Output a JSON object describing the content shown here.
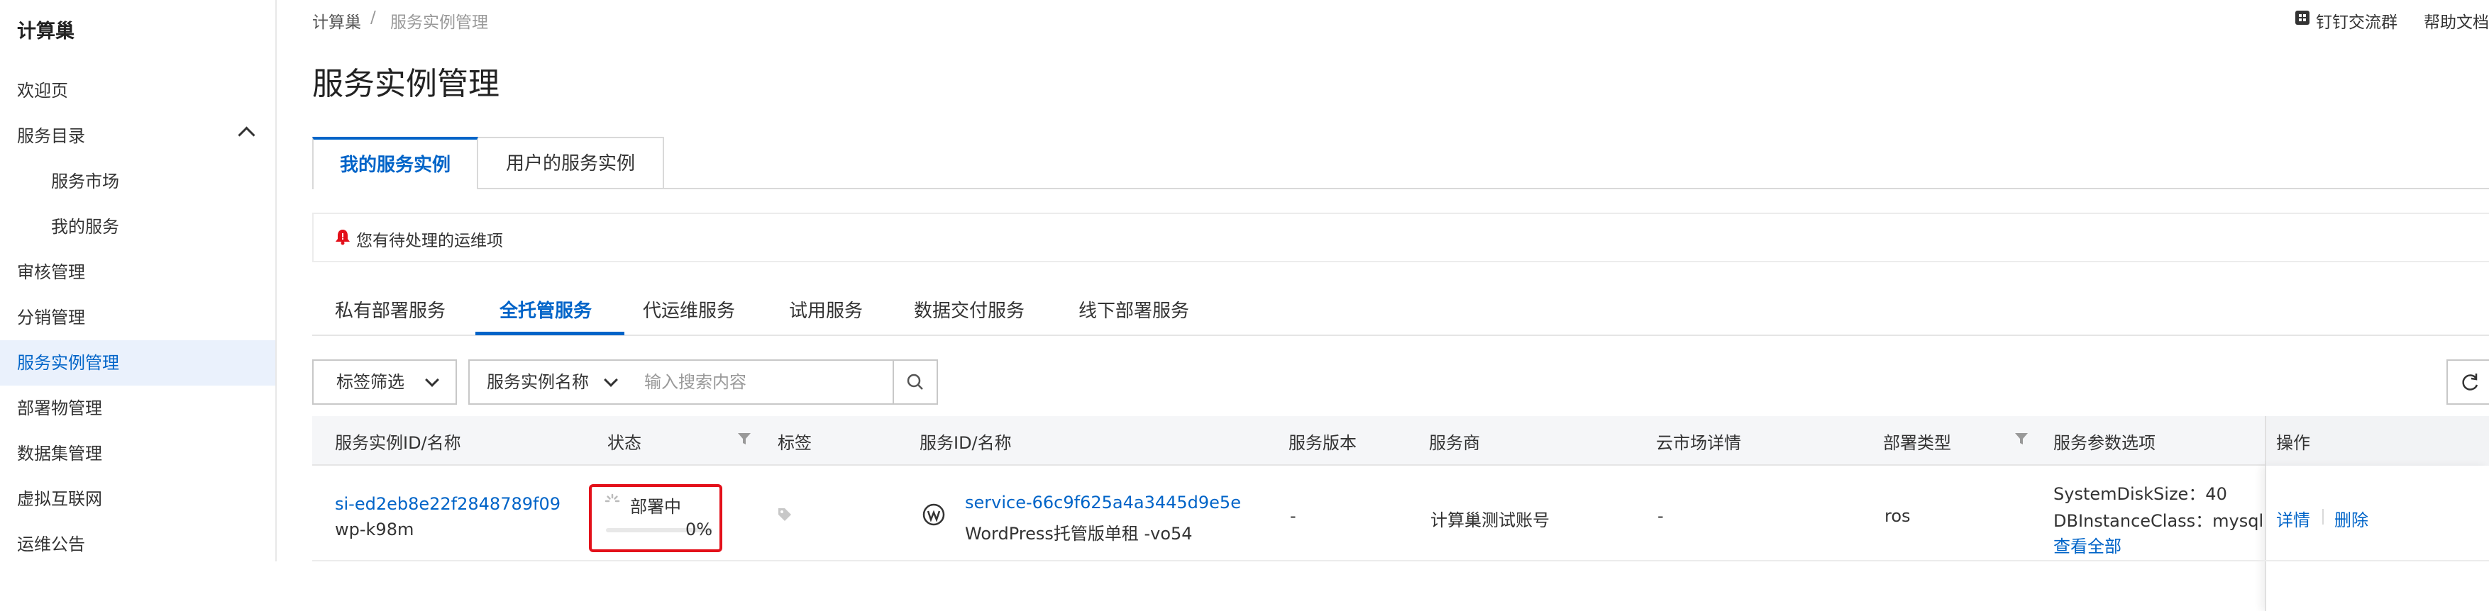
{
  "sidebar": {
    "title": "计算巢",
    "items": [
      {
        "label": "欢迎页"
      },
      {
        "label": "服务目录"
      },
      {
        "label": "服务市场"
      },
      {
        "label": "我的服务"
      },
      {
        "label": "审核管理"
      },
      {
        "label": "分销管理"
      },
      {
        "label": "服务实例管理"
      },
      {
        "label": "部署物管理"
      },
      {
        "label": "数据集管理"
      },
      {
        "label": "虚拟互联网"
      },
      {
        "label": "运维公告"
      }
    ]
  },
  "header": {
    "breadcrumb": [
      "计算巢",
      "服务实例管理"
    ],
    "separator": "/",
    "links": [
      "钉钉交流群",
      "帮助文档"
    ]
  },
  "page": {
    "title": "服务实例管理",
    "tabs": [
      "我的服务实例",
      "用户的服务实例"
    ],
    "notice": "您有待处理的运维项",
    "subtabs": [
      "私有部署服务",
      "全托管服务",
      "代运维服务",
      "试用服务",
      "数据交付服务",
      "线下部署服务"
    ]
  },
  "filters": {
    "tag_filter": "标签筛选",
    "field_select": "服务实例名称",
    "search_placeholder": "输入搜索内容"
  },
  "table": {
    "columns": [
      "服务实例ID/名称",
      "状态",
      "标签",
      "服务ID/名称",
      "服务版本",
      "服务商",
      "云市场详情",
      "部署类型",
      "服务参数选项",
      "操作"
    ],
    "rows": [
      {
        "instance_id": "si-ed2eb8e22f2848789f09",
        "instance_name": "wp-k98m",
        "status": "部署中",
        "progress_text": "0%",
        "progress": 0,
        "service_id": "service-66c9f625a4a3445d9e5e",
        "service_name": "WordPress托管版单租 -vo54",
        "version": "-",
        "provider": "计算巢测试账号",
        "market": "-",
        "deploy_type": "ros",
        "params": [
          "SystemDiskSize：40",
          "DBInstanceClass：mysql.n"
        ],
        "view_all": "查看全部",
        "actions": [
          "详情",
          "删除"
        ]
      }
    ]
  },
  "colors": {
    "accent": "#0064c8",
    "highlight": "#e3101a",
    "active_bg": "#eaf1fc"
  },
  "icons": [
    "chevron-up-icon",
    "bell-alert-icon",
    "search-icon",
    "refresh-icon",
    "filter-icon",
    "tag-icon",
    "wordpress-icon",
    "dingtalk-icon",
    "spinner-icon"
  ]
}
